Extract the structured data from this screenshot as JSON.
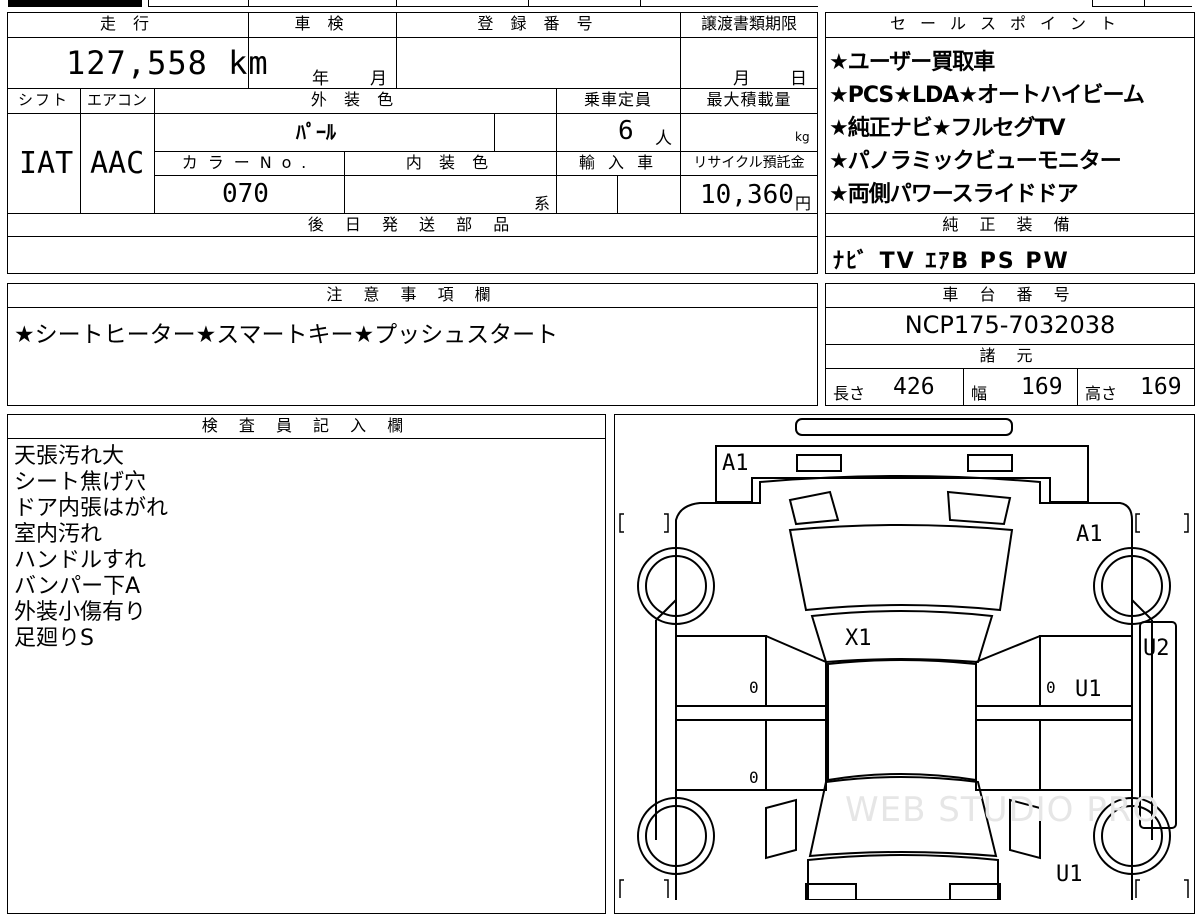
{
  "headers": {
    "mileage": "走 行",
    "inspection": "車 検",
    "registration": "登 録 番 号",
    "transfer_deadline": "譲渡書類期限",
    "sales_points": "セールスポイント",
    "shift": "シフト",
    "aircon": "エアコン",
    "exterior_color": "外 装 色",
    "capacity": "乗車定員",
    "max_load": "最大積載量",
    "color_no": "カラーNo.",
    "interior_color": "内 装 色",
    "import": "輸 入 車",
    "recycle": "リサイクル預託金",
    "later_parts": "後 日 発 送 部 品",
    "genuine_equipment": "純 正 装 備",
    "notes": "注 意 事 項 欄",
    "chassis": "車 台 番 号",
    "specs": "諸 元",
    "inspector": "検 査 員 記 入 欄"
  },
  "values": {
    "mileage": "127,558 km",
    "inspection_year": "年",
    "inspection_month": "月",
    "deadline_month": "月",
    "deadline_day": "日",
    "shift": "IAT",
    "aircon": "AAC",
    "exterior_color": "ﾊﾟｰﾙ",
    "capacity": "6",
    "capacity_unit": "人",
    "max_load_unit": "kg",
    "color_no": "070",
    "interior_suffix": "系",
    "recycle_fee": "10,360",
    "recycle_unit": "円",
    "genuine_equipment": "ﾅﾋﾞ TV ｴｱB PS PW",
    "notes": "★シートヒーター★スマートキー★プッシュスタート",
    "chassis": "NCP175-7032038",
    "length_label": "長さ",
    "length": "426",
    "width_label": "幅",
    "width": "169",
    "height_label": "高さ",
    "height": "169"
  },
  "sales_points": [
    "★ユーザー買取車",
    "★PCS★LDA★オートハイビーム",
    "★純正ナビ★フルセグTV",
    "★パノラミックビューモニター",
    "★両側パワースライドドア"
  ],
  "inspector_notes": [
    "天張汚れ大",
    "シート焦げ穴",
    "ドア内張はがれ",
    "室内汚れ",
    "ハンドルすれ",
    "バンパー下A",
    "外装小傷有り",
    "足廻りS"
  ],
  "diagram_marks": {
    "front_bumper": "A1",
    "front_right": "A1",
    "windshield": "X1",
    "right_side": "U2",
    "right_front_door": "U1",
    "right_rear": "U1",
    "left_front_door_zero": "0",
    "left_rear_door_zero": "0",
    "right_front_door_zero": "0"
  },
  "watermark": "WEB STUDIO PRO"
}
